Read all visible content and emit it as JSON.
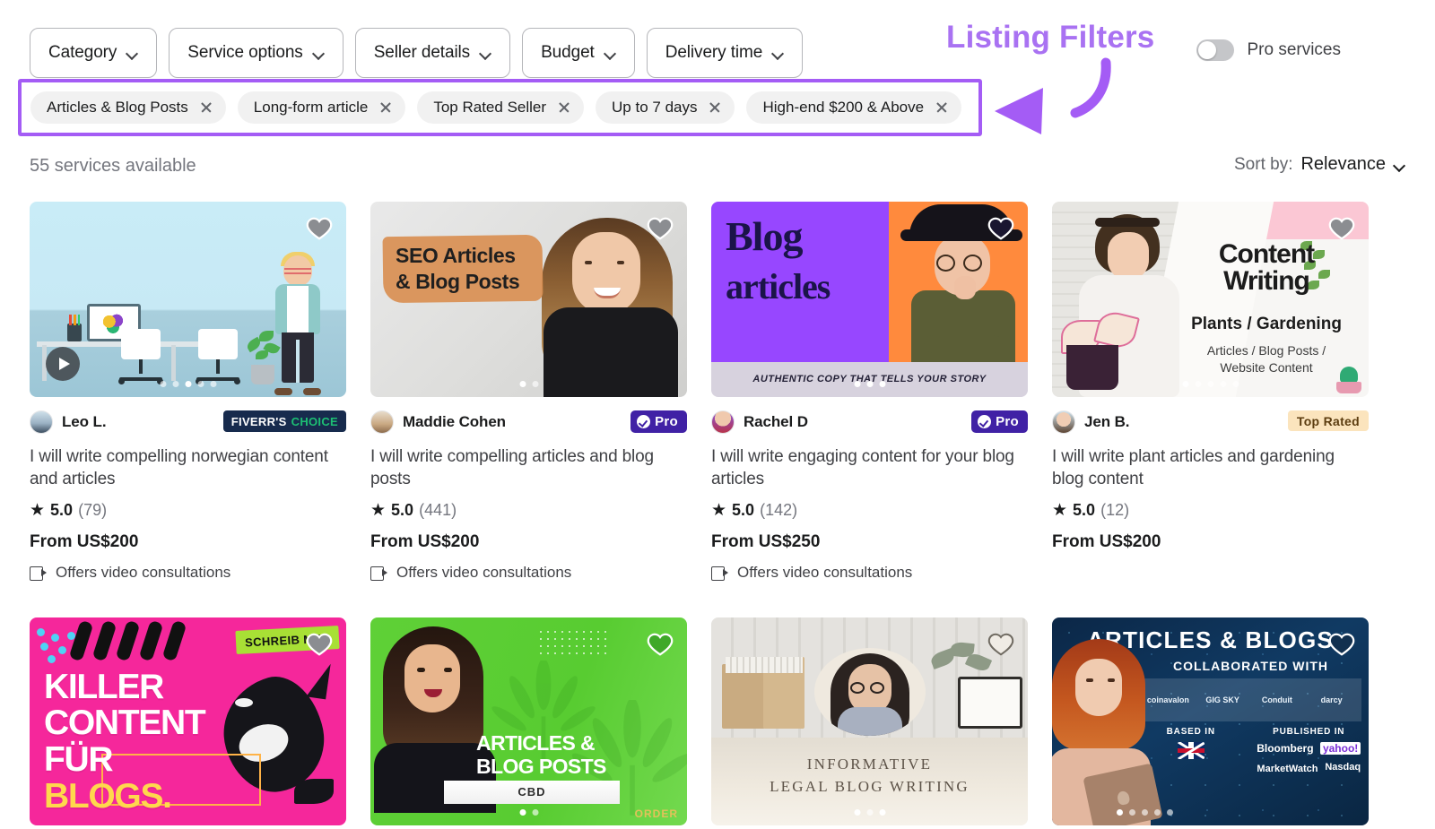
{
  "annotation": {
    "title": "Listing Filters",
    "color": "#a45cf5"
  },
  "filters": {
    "buttons": [
      {
        "label": "Category",
        "name": "category"
      },
      {
        "label": "Service options",
        "name": "service-options"
      },
      {
        "label": "Seller details",
        "name": "seller-details"
      },
      {
        "label": "Budget",
        "name": "budget"
      },
      {
        "label": "Delivery time",
        "name": "delivery-time"
      }
    ],
    "chips": [
      {
        "label": "Articles & Blog Posts"
      },
      {
        "label": "Long-form article"
      },
      {
        "label": "Top Rated Seller"
      },
      {
        "label": "Up to 7 days"
      },
      {
        "label": "High-end $200 & Above"
      }
    ],
    "pro_services": {
      "label": "Pro services",
      "enabled": false
    }
  },
  "results": {
    "count_text": "55 services available",
    "sort_label": "Sort by:",
    "sort_value": "Relevance"
  },
  "cards": [
    {
      "thumb_kind": "office",
      "thumb_texts": {},
      "has_video": true,
      "dots": {
        "total": 5,
        "active": 2
      },
      "seller": "Leo L.",
      "badge": {
        "type": "choice",
        "label_1": "FIVERR'S",
        "label_2": "CHOICE"
      },
      "title": "I will write compelling norwegian content and articles",
      "rating": "5.0",
      "reviews": "(79)",
      "price": "From US$200",
      "video_consult": "Offers video consultations"
    },
    {
      "thumb_kind": "seo",
      "thumb_texts": {
        "line1": "SEO Articles",
        "line2": "& Blog Posts"
      },
      "has_video": false,
      "dots": {
        "total": 2,
        "active": 0
      },
      "seller": "Maddie Cohen",
      "badge": {
        "type": "pro",
        "label": "Pro"
      },
      "title": "I will write compelling articles and blog posts",
      "rating": "5.0",
      "reviews": "(441)",
      "price": "From US$200",
      "video_consult": "Offers video consultations"
    },
    {
      "thumb_kind": "blog",
      "thumb_texts": {
        "line1": "Blog",
        "line2": "articles",
        "caption": "AUTHENTIC COPY THAT TELLS YOUR STORY"
      },
      "has_video": false,
      "dots": {
        "total": 3,
        "active": 0
      },
      "seller": "Rachel D",
      "badge": {
        "type": "pro",
        "label": "Pro"
      },
      "title": "I will write engaging content for your blog articles",
      "rating": "5.0",
      "reviews": "(142)",
      "price": "From US$250",
      "video_consult": "Offers video consultations"
    },
    {
      "thumb_kind": "plant",
      "thumb_texts": {
        "line1": "Content",
        "line2": "Writing",
        "sub": "Plants / Gardening",
        "small1": "Articles / Blog Posts /",
        "small2": "Website Content"
      },
      "has_video": false,
      "dots": {
        "total": 5,
        "active": 0
      },
      "seller": "Jen B.",
      "badge": {
        "type": "toprated",
        "label": "Top Rated"
      },
      "title": "I will write plant articles and gardening blog content",
      "rating": "5.0",
      "reviews": "(12)",
      "price": "From US$200",
      "video_consult": ""
    },
    {
      "thumb_kind": "killer",
      "thumb_texts": {
        "badge": "SCHREIB MIR!",
        "line1": "KILLER",
        "line2": "CONTENT",
        "line3a": "FÜR ",
        "line3b": "BLOGS."
      },
      "has_video": false,
      "dots": {
        "total": 0,
        "active": 0
      },
      "seller": "",
      "badge": null,
      "title": "",
      "rating": "",
      "reviews": "",
      "price": "",
      "video_consult": ""
    },
    {
      "thumb_kind": "green",
      "thumb_texts": {
        "line1": "ARTICLES &",
        "line2": "BLOG POSTS",
        "bar": "CBD",
        "corner": "ORDER"
      },
      "has_video": false,
      "dots": {
        "total": 2,
        "active": 0
      },
      "seller": "",
      "badge": null,
      "title": "",
      "rating": "",
      "reviews": "",
      "price": "",
      "video_consult": ""
    },
    {
      "thumb_kind": "legal",
      "thumb_texts": {
        "line1": "INFORMATIVE",
        "line2": "LEGAL BLOG WRITING"
      },
      "has_video": false,
      "dots": {
        "total": 3,
        "active": 0
      },
      "seller": "",
      "badge": null,
      "title": "",
      "rating": "",
      "reviews": "",
      "price": "",
      "video_consult": ""
    },
    {
      "thumb_kind": "dark",
      "thumb_texts": {
        "line1": "ARTICLES & BLOGS",
        "line2": "COLLABORATED WITH",
        "logo1": "coinavalon",
        "logo2": "GIG SKY",
        "logo3": "Conduit",
        "logo4": "darcy",
        "based_in": "BASED IN",
        "published_in": "PUBLISHED IN",
        "pub1": "Bloomberg",
        "pub2": "yahoo!",
        "pub3": "MarketWatch",
        "pub4": "Nasdaq"
      },
      "has_video": false,
      "dots": {
        "total": 5,
        "active": 0
      },
      "seller": "",
      "badge": null,
      "title": "",
      "rating": "",
      "reviews": "",
      "price": "",
      "video_consult": ""
    }
  ]
}
